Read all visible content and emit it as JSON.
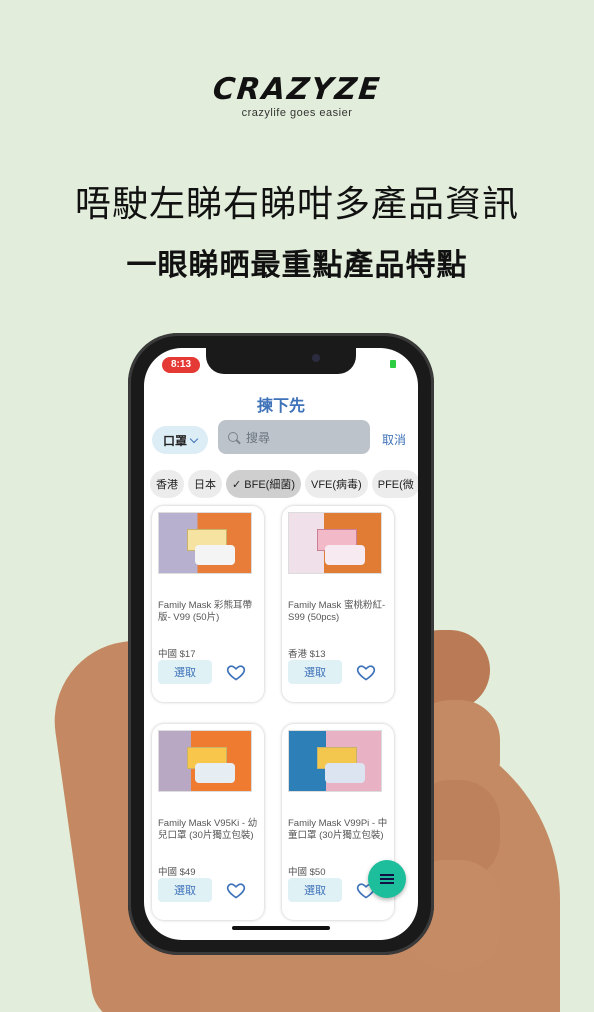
{
  "brand": {
    "logo": "CRAZYZE",
    "tagline": "crazylife goes easier"
  },
  "headline": "唔駛左睇右睇咁多產品資訊",
  "subline": "一眼睇晒最重點產品特點",
  "phone": {
    "time": "8:13",
    "app_title": "揀下先",
    "category": "口罩",
    "search_placeholder": "搜尋",
    "cancel": "取消",
    "chips": [
      "香港",
      "日本",
      "✓ BFE(細菌)",
      "VFE(病毒)",
      "PFE(微"
    ],
    "products": [
      {
        "name": "Family Mask 彩熊耳帶版- V99 (50片)",
        "origin_price": "中國  $17",
        "button": "選取"
      },
      {
        "name": "Family Mask 蜜桃粉紅- S99 (50pcs)",
        "origin_price": "香港  $13",
        "button": "選取"
      },
      {
        "name": "Family Mask V95Ki - 幼兒口罩 (30片獨立包裝)",
        "origin_price": "中國  $49",
        "button": "選取"
      },
      {
        "name": "Family Mask V99Pi - 中童口罩 (30片獨立包裝)",
        "origin_price": "中國  $50",
        "button": "選取"
      }
    ]
  },
  "colors": {
    "background": "#e2eedb",
    "accent": "#3f73b9",
    "fab": "#1cbe9b"
  },
  "icons": {
    "search": "search-icon",
    "heart": "heart-icon",
    "menu": "menu-icon",
    "chevron": "chevron-down-icon"
  }
}
